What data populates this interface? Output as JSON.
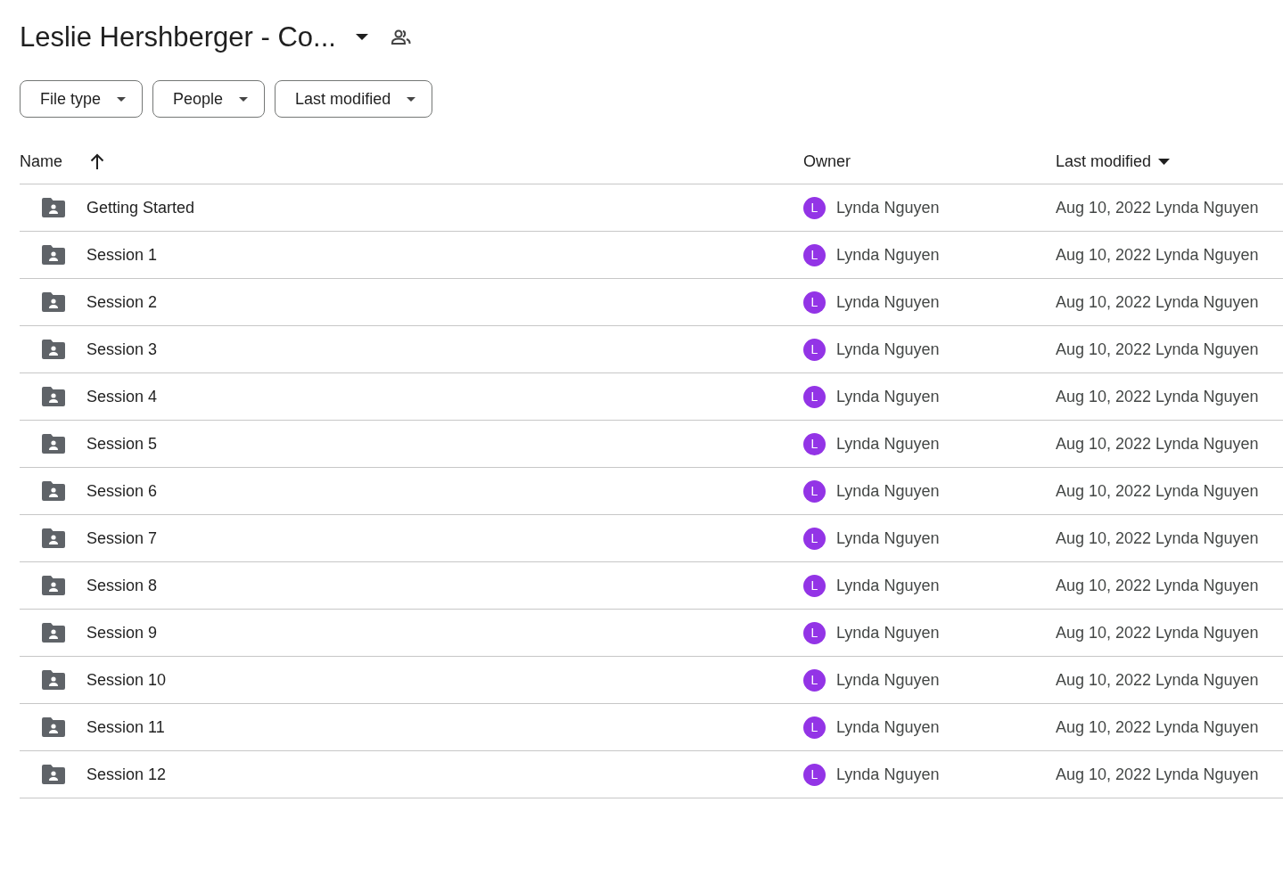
{
  "header": {
    "title": "Leslie Hershberger - Co..."
  },
  "filters": [
    {
      "label": "File type"
    },
    {
      "label": "People"
    },
    {
      "label": "Last modified"
    }
  ],
  "table": {
    "columns": [
      "Name",
      "Owner",
      "Last modified"
    ],
    "rows": [
      {
        "name": "Getting Started",
        "owner": "Lynda Nguyen",
        "owner_initial": "L",
        "modified": "Aug 10, 2022",
        "modified_by": "Lynda Nguyen"
      },
      {
        "name": "Session 1",
        "owner": "Lynda Nguyen",
        "owner_initial": "L",
        "modified": "Aug 10, 2022",
        "modified_by": "Lynda Nguyen"
      },
      {
        "name": "Session 2",
        "owner": "Lynda Nguyen",
        "owner_initial": "L",
        "modified": "Aug 10, 2022",
        "modified_by": "Lynda Nguyen"
      },
      {
        "name": "Session 3",
        "owner": "Lynda Nguyen",
        "owner_initial": "L",
        "modified": "Aug 10, 2022",
        "modified_by": "Lynda Nguyen"
      },
      {
        "name": "Session 4",
        "owner": "Lynda Nguyen",
        "owner_initial": "L",
        "modified": "Aug 10, 2022",
        "modified_by": "Lynda Nguyen"
      },
      {
        "name": "Session 5",
        "owner": "Lynda Nguyen",
        "owner_initial": "L",
        "modified": "Aug 10, 2022",
        "modified_by": "Lynda Nguyen"
      },
      {
        "name": "Session 6",
        "owner": "Lynda Nguyen",
        "owner_initial": "L",
        "modified": "Aug 10, 2022",
        "modified_by": "Lynda Nguyen"
      },
      {
        "name": "Session 7",
        "owner": "Lynda Nguyen",
        "owner_initial": "L",
        "modified": "Aug 10, 2022",
        "modified_by": "Lynda Nguyen"
      },
      {
        "name": "Session 8",
        "owner": "Lynda Nguyen",
        "owner_initial": "L",
        "modified": "Aug 10, 2022",
        "modified_by": "Lynda Nguyen"
      },
      {
        "name": "Session 9",
        "owner": "Lynda Nguyen",
        "owner_initial": "L",
        "modified": "Aug 10, 2022",
        "modified_by": "Lynda Nguyen"
      },
      {
        "name": "Session 10",
        "owner": "Lynda Nguyen",
        "owner_initial": "L",
        "modified": "Aug 10, 2022",
        "modified_by": "Lynda Nguyen"
      },
      {
        "name": "Session 11",
        "owner": "Lynda Nguyen",
        "owner_initial": "L",
        "modified": "Aug 10, 2022",
        "modified_by": "Lynda Nguyen"
      },
      {
        "name": "Session 12",
        "owner": "Lynda Nguyen",
        "owner_initial": "L",
        "modified": "Aug 10, 2022",
        "modified_by": "Lynda Nguyen"
      }
    ]
  }
}
